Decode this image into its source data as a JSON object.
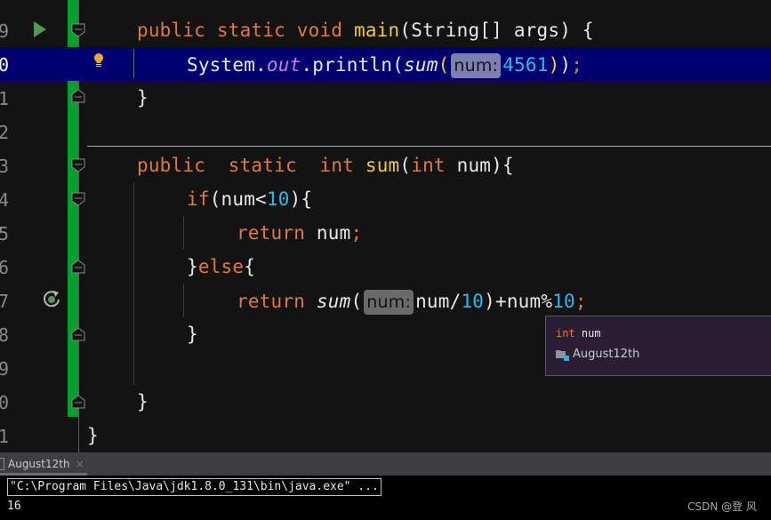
{
  "editor": {
    "lines": [
      {
        "num": "9",
        "tokens": [
          [
            "kw",
            "public static void "
          ],
          [
            "fn",
            "main"
          ],
          [
            "",
            "(String[] args) {"
          ]
        ]
      },
      {
        "num": "0",
        "current": true
      },
      {
        "num": "1"
      },
      {
        "num": "2"
      },
      {
        "num": "3"
      },
      {
        "num": "4"
      },
      {
        "num": "5"
      },
      {
        "num": "6"
      },
      {
        "num": "7"
      },
      {
        "num": "8"
      },
      {
        "num": "9"
      },
      {
        "num": "0"
      },
      {
        "num": "1"
      }
    ],
    "code": {
      "l9_kw": "public static void ",
      "l9_fn": "main",
      "l9_rest": "(String[] args) {",
      "l10_system": "System.",
      "l10_out": "out",
      "l10_println": ".println(",
      "l10_sum": "sum",
      "l10_open": "(",
      "l10_hint": "num:",
      "l10_val": "4561",
      "l10_close_inner": ")",
      "l10_close_outer": ")",
      "l10_semi": ";",
      "l11": "}",
      "l13_kw1": "public  static  int ",
      "l13_fn": "sum",
      "l13_open": "(",
      "l13_kw2": "int",
      "l13_rest": " num){",
      "l14_kw": "if",
      "l14_a": "(num<",
      "l14_num": "10",
      "l14_b": "){",
      "l15_kw": "return ",
      "l15_a": "num",
      "l15_semi": ";",
      "l16_a": "}",
      "l16_kw": "else",
      "l16_b": "{",
      "l17_kw": "return ",
      "l17_fn": "sum",
      "l17_open": "(",
      "l17_hint": "num:",
      "l17_a": "num/",
      "l17_n1": "10",
      "l17_b": ")+num%",
      "l17_n2": "10",
      "l17_semi": ";",
      "l18": "}",
      "l20": "}",
      "l21": "}"
    },
    "line_numbers": [
      "9",
      "0",
      "1",
      "2",
      "3",
      "4",
      "5",
      "6",
      "7",
      "8",
      "9",
      "0",
      "1"
    ]
  },
  "popup": {
    "type": "int",
    "name": "num",
    "location": "August12th"
  },
  "run_panel": {
    "tab_label": "August12th",
    "close_glyph": "×",
    "command": "\"C:\\Program Files\\Java\\jdk1.8.0_131\\bin\\java.exe\" ...",
    "output": "16"
  },
  "watermark": "CSDN @登 风",
  "colors": {
    "keyword": "#e07a3d",
    "function": "#f2c94c",
    "number": "#2fb8f0",
    "current_line": "#000070",
    "changed_gutter": "#00a12a"
  }
}
